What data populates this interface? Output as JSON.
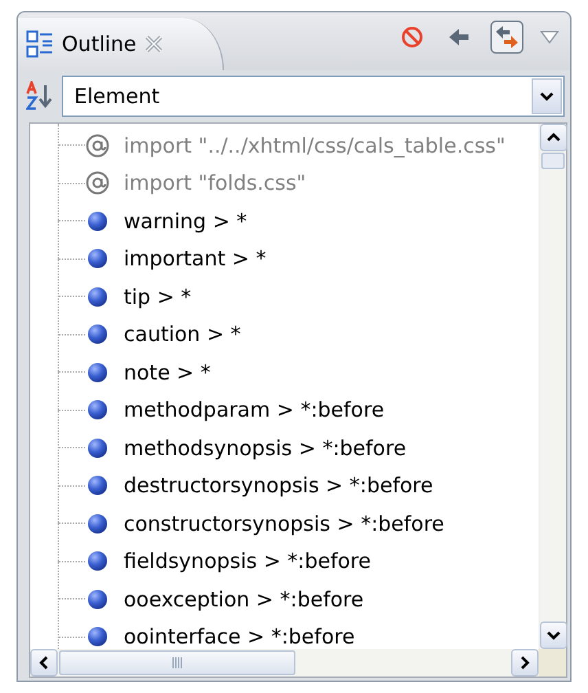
{
  "tab": {
    "title": "Outline",
    "selected": true
  },
  "sort_field": {
    "value": "Element"
  },
  "outline": {
    "items": [
      {
        "kind": "import",
        "label": "import \"../../xhtml/css/cals_table.css\""
      },
      {
        "kind": "import",
        "label": "import \"folds.css\""
      },
      {
        "kind": "rule",
        "label": "warning > *"
      },
      {
        "kind": "rule",
        "label": "important > *"
      },
      {
        "kind": "rule",
        "label": "tip > *"
      },
      {
        "kind": "rule",
        "label": "caution > *"
      },
      {
        "kind": "rule",
        "label": "note > *"
      },
      {
        "kind": "rule",
        "label": "methodparam > *:before"
      },
      {
        "kind": "rule",
        "label": "methodsynopsis > *:before"
      },
      {
        "kind": "rule",
        "label": "destructorsynopsis > *:before"
      },
      {
        "kind": "rule",
        "label": "constructorsynopsis > *:before"
      },
      {
        "kind": "rule",
        "label": "fieldsynopsis > *:before"
      },
      {
        "kind": "rule",
        "label": "ooexception > *:before"
      },
      {
        "kind": "rule",
        "label": "oointerface > *:before"
      }
    ]
  }
}
